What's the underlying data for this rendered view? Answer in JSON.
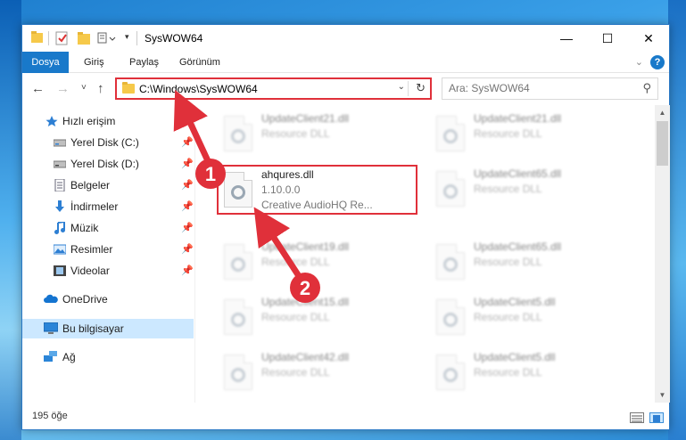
{
  "window": {
    "title": "SysWOW64"
  },
  "window_controls": {
    "minimize": "—",
    "maximize": "☐",
    "close": "✕"
  },
  "ribbon": {
    "tabs": [
      "Dosya",
      "Giriş",
      "Paylaş",
      "Görünüm"
    ],
    "help": "?",
    "collapse": "⌄"
  },
  "nav": {
    "back": "←",
    "forward": "→",
    "recent": "˅",
    "up": "↑",
    "address": "C:\\Windows\\SysWOW64",
    "dropdown": "⌄",
    "refresh": "↻",
    "search_placeholder": "Ara: SysWOW64",
    "search_icon": "⚲"
  },
  "sidebar": {
    "items": [
      {
        "label": "Hızlı erişim",
        "icon": "star-icon"
      },
      {
        "label": "Yerel Disk (C:)",
        "icon": "drive-icon",
        "pinned": true
      },
      {
        "label": "Yerel Disk (D:)",
        "icon": "drive-icon",
        "pinned": true
      },
      {
        "label": "Belgeler",
        "icon": "document-icon",
        "pinned": true
      },
      {
        "label": "İndirmeler",
        "icon": "download-icon",
        "pinned": true
      },
      {
        "label": "Müzik",
        "icon": "music-icon",
        "pinned": true
      },
      {
        "label": "Resimler",
        "icon": "pictures-icon",
        "pinned": true
      },
      {
        "label": "Videolar",
        "icon": "video-icon",
        "pinned": true
      },
      {
        "label": "OneDrive",
        "icon": "cloud-icon"
      },
      {
        "label": "Bu bilgisayar",
        "icon": "computer-icon",
        "selected": true
      },
      {
        "label": "Ağ",
        "icon": "network-icon"
      }
    ],
    "pin_glyph": "📌"
  },
  "files": {
    "left": [
      {
        "name": "UpdateClient21.dll",
        "type": "Resource DLL"
      },
      {
        "name": "ahqures.dll",
        "version": "1.10.0.0",
        "desc": "Creative AudioHQ Re..."
      },
      {
        "name": "UpdateClient19.dll",
        "type": "Resource DLL"
      },
      {
        "name": "UpdateClient15.dll",
        "type": "Resource DLL"
      },
      {
        "name": "UpdateClient42.dll",
        "type": "Resource DLL"
      }
    ],
    "right": [
      {
        "name": "UpdateClient21.dll",
        "type": "Resource DLL"
      },
      {
        "name": "UpdateClient65.dll",
        "type": "Resource DLL"
      },
      {
        "name": "UpdateClient65.dll",
        "type": "Resource DLL"
      },
      {
        "name": "UpdateClient5.dll",
        "type": "Resource DLL"
      },
      {
        "name": "UpdateClient5.dll",
        "type": "Resource DLL"
      }
    ]
  },
  "annotations": {
    "step1": "1",
    "step2": "2",
    "color": "#e0303a"
  },
  "status": {
    "count": "195 öğe"
  },
  "scroll": {
    "up": "▲",
    "down": "▼"
  }
}
